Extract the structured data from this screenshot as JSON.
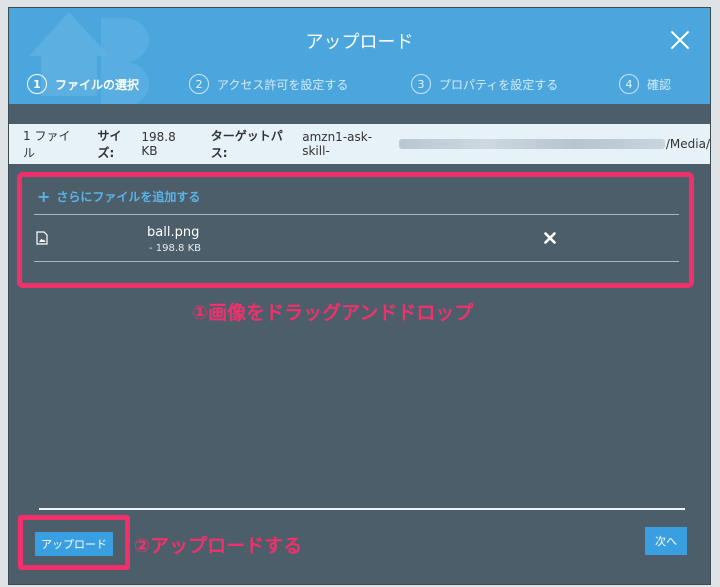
{
  "dialog": {
    "title": "アップロード",
    "close_icon": "close-icon"
  },
  "steps": [
    {
      "num": "1",
      "label": "ファイルの選択",
      "active": true
    },
    {
      "num": "2",
      "label": "アクセス許可を設定する",
      "active": false
    },
    {
      "num": "3",
      "label": "プロパティを設定する",
      "active": false
    },
    {
      "num": "4",
      "label": "確認",
      "active": false
    }
  ],
  "info": {
    "file_count": "1 ファイル",
    "size_label": "サイズ:",
    "size_value": "198.8 KB",
    "path_label": "ターゲットパス:",
    "path_prefix": "amzn1-ask-skill-",
    "path_suffix": "/Media/"
  },
  "upload_area": {
    "add_files_label": "さらにファイルを追加する",
    "file": {
      "name": "ball.png",
      "size": "- 198.8 KB",
      "icon": "image-file-icon",
      "remove_icon": "remove-icon"
    }
  },
  "annotations": {
    "step1": "①画像をドラッグアンドドロップ",
    "step2": "②アップロードする"
  },
  "footer": {
    "upload_label": "アップロード",
    "next_label": "次へ"
  },
  "colors": {
    "header": "#4aa6dc",
    "body": "#4b5e6a",
    "accent": "#3a9fe0",
    "highlight": "#f0306a"
  }
}
